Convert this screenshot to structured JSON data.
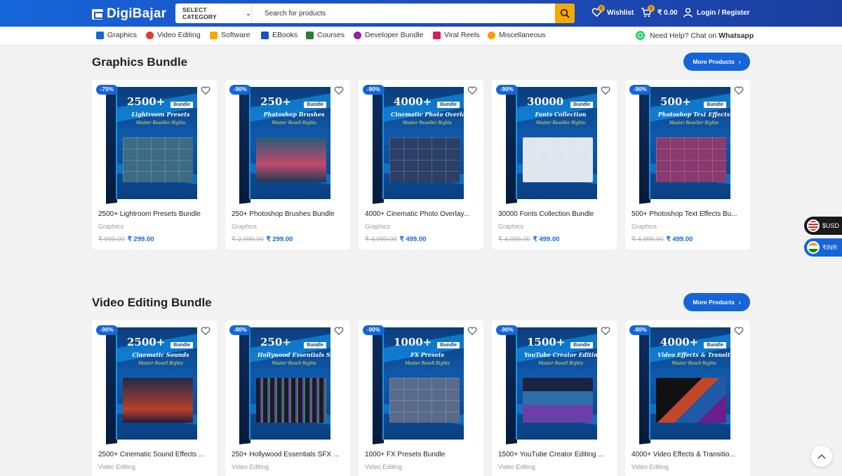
{
  "header": {
    "logo": "DigiBajar",
    "category_label": "SELECT CATEGORY",
    "search_placeholder": "Search for products",
    "wishlist_label": "Wishlist",
    "wishlist_count": "0",
    "cart_count": "0",
    "cart_total": "₹ 0.00",
    "login_label": "Login / Register"
  },
  "nav": {
    "items": [
      {
        "label": "Graphics",
        "icon": "graphics-icon",
        "color": "#1565d8"
      },
      {
        "label": "Video Editing",
        "icon": "video-icon",
        "color": "#e53935"
      },
      {
        "label": "Software",
        "icon": "software-icon",
        "color": "#f5a800"
      },
      {
        "label": "EBooks",
        "icon": "ebook-icon",
        "color": "#1d4fc4"
      },
      {
        "label": "Courses",
        "icon": "courses-icon",
        "color": "#2e7d32"
      },
      {
        "label": "Developer Bundle",
        "icon": "developer-icon",
        "color": "#8e24aa"
      },
      {
        "label": "Viral Reels",
        "icon": "reels-icon",
        "color": "#d81b60"
      },
      {
        "label": "Miscellaneous",
        "icon": "misc-icon",
        "color": "#ff9800"
      }
    ],
    "help_prefix": "Need Help? Chat on",
    "help_link": "Whatsapp"
  },
  "sections": [
    {
      "title": "Graphics Bundle",
      "more_label": "More Products",
      "products": [
        {
          "discount": "-70%",
          "box_num": "2500+",
          "box_sub": "Lightroom Presets",
          "box_rr": "Master Reseller Rights",
          "box_tag": "Bundle",
          "name": "2500+ Lightroom Presets Bundle",
          "category": "Graphics",
          "old_price": "₹ 999.00",
          "price": "₹ 299.00"
        },
        {
          "discount": "-90%",
          "box_num": "250+",
          "box_sub": "Photoshop Brushes",
          "box_rr": "Master Resell Rights",
          "box_tag": "Bundle",
          "name": "250+ Photoshop Brushes Bundle",
          "category": "Graphics",
          "old_price": "₹ 2,999.00",
          "price": "₹ 299.00"
        },
        {
          "discount": "-90%",
          "box_num": "4000+",
          "box_sub": "Cinematic Photo Overlays",
          "box_rr": "Master Reseller Rights",
          "box_tag": "Bundle",
          "name": "4000+ Cinematic Photo Overlay...",
          "category": "Graphics",
          "old_price": "₹ 4,999.00",
          "price": "₹ 499.00"
        },
        {
          "discount": "-90%",
          "box_num": "30000",
          "box_sub": "Fonts Collection",
          "box_rr": "Master Reseller Rights",
          "box_tag": "Bundle",
          "name": "30000 Fonts Collection Bundle",
          "category": "Graphics",
          "old_price": "₹ 4,999.00",
          "price": "₹ 499.00"
        },
        {
          "discount": "-90%",
          "box_num": "500+",
          "box_sub": "Photoshop Text Effects",
          "box_rr": "Master Reseller Rights",
          "box_tag": "Bundle",
          "name": "500+ Photoshop Text Effects Bu...",
          "category": "Graphics",
          "old_price": "₹ 4,999.00",
          "price": "₹ 499.00"
        }
      ]
    },
    {
      "title": "Video Editing Bundle",
      "more_label": "More Products",
      "products": [
        {
          "discount": "-90%",
          "box_num": "2500+",
          "box_sub": "Cinematic Sounds",
          "box_rr": "Master Resell Rights",
          "box_tag": "Bundle",
          "name": "2500+ Cinematic Sound Effects ...",
          "category": "Video Editing"
        },
        {
          "discount": "-90%",
          "box_num": "250+",
          "box_sub": "Hollywood Essentials SFX",
          "box_rr": "Master Resell Rights",
          "box_tag": "Bundle",
          "name": "250+ Hollywood Essentials SFX ...",
          "category": "Video Editing"
        },
        {
          "discount": "-90%",
          "box_num": "1000+",
          "box_sub": "FX Presets",
          "box_rr": "Master Resell Rights",
          "box_tag": "Bundle",
          "name": "1000+ FX Presets Bundle",
          "category": "Video Editing"
        },
        {
          "discount": "-90%",
          "box_num": "1500+",
          "box_sub": "YouTube Creator Editing Preset",
          "box_rr": "Master Resell Rights",
          "box_tag": "Bundle",
          "name": "1500+ YouTube Creator Editing ...",
          "category": "Video Editing"
        },
        {
          "discount": "-90%",
          "box_num": "4000+",
          "box_sub": "Video Effects & Transitions",
          "box_rr": "Master Resell Rights",
          "box_tag": "Bundle",
          "name": "4000+ Video Effects & Transitio...",
          "category": "Video Editing"
        }
      ]
    }
  ],
  "currency": {
    "usd_label": "$USD",
    "inr_label": "₹INR"
  },
  "colors": {
    "brand_blue": "#1565d8",
    "accent_orange": "#f5a800"
  }
}
